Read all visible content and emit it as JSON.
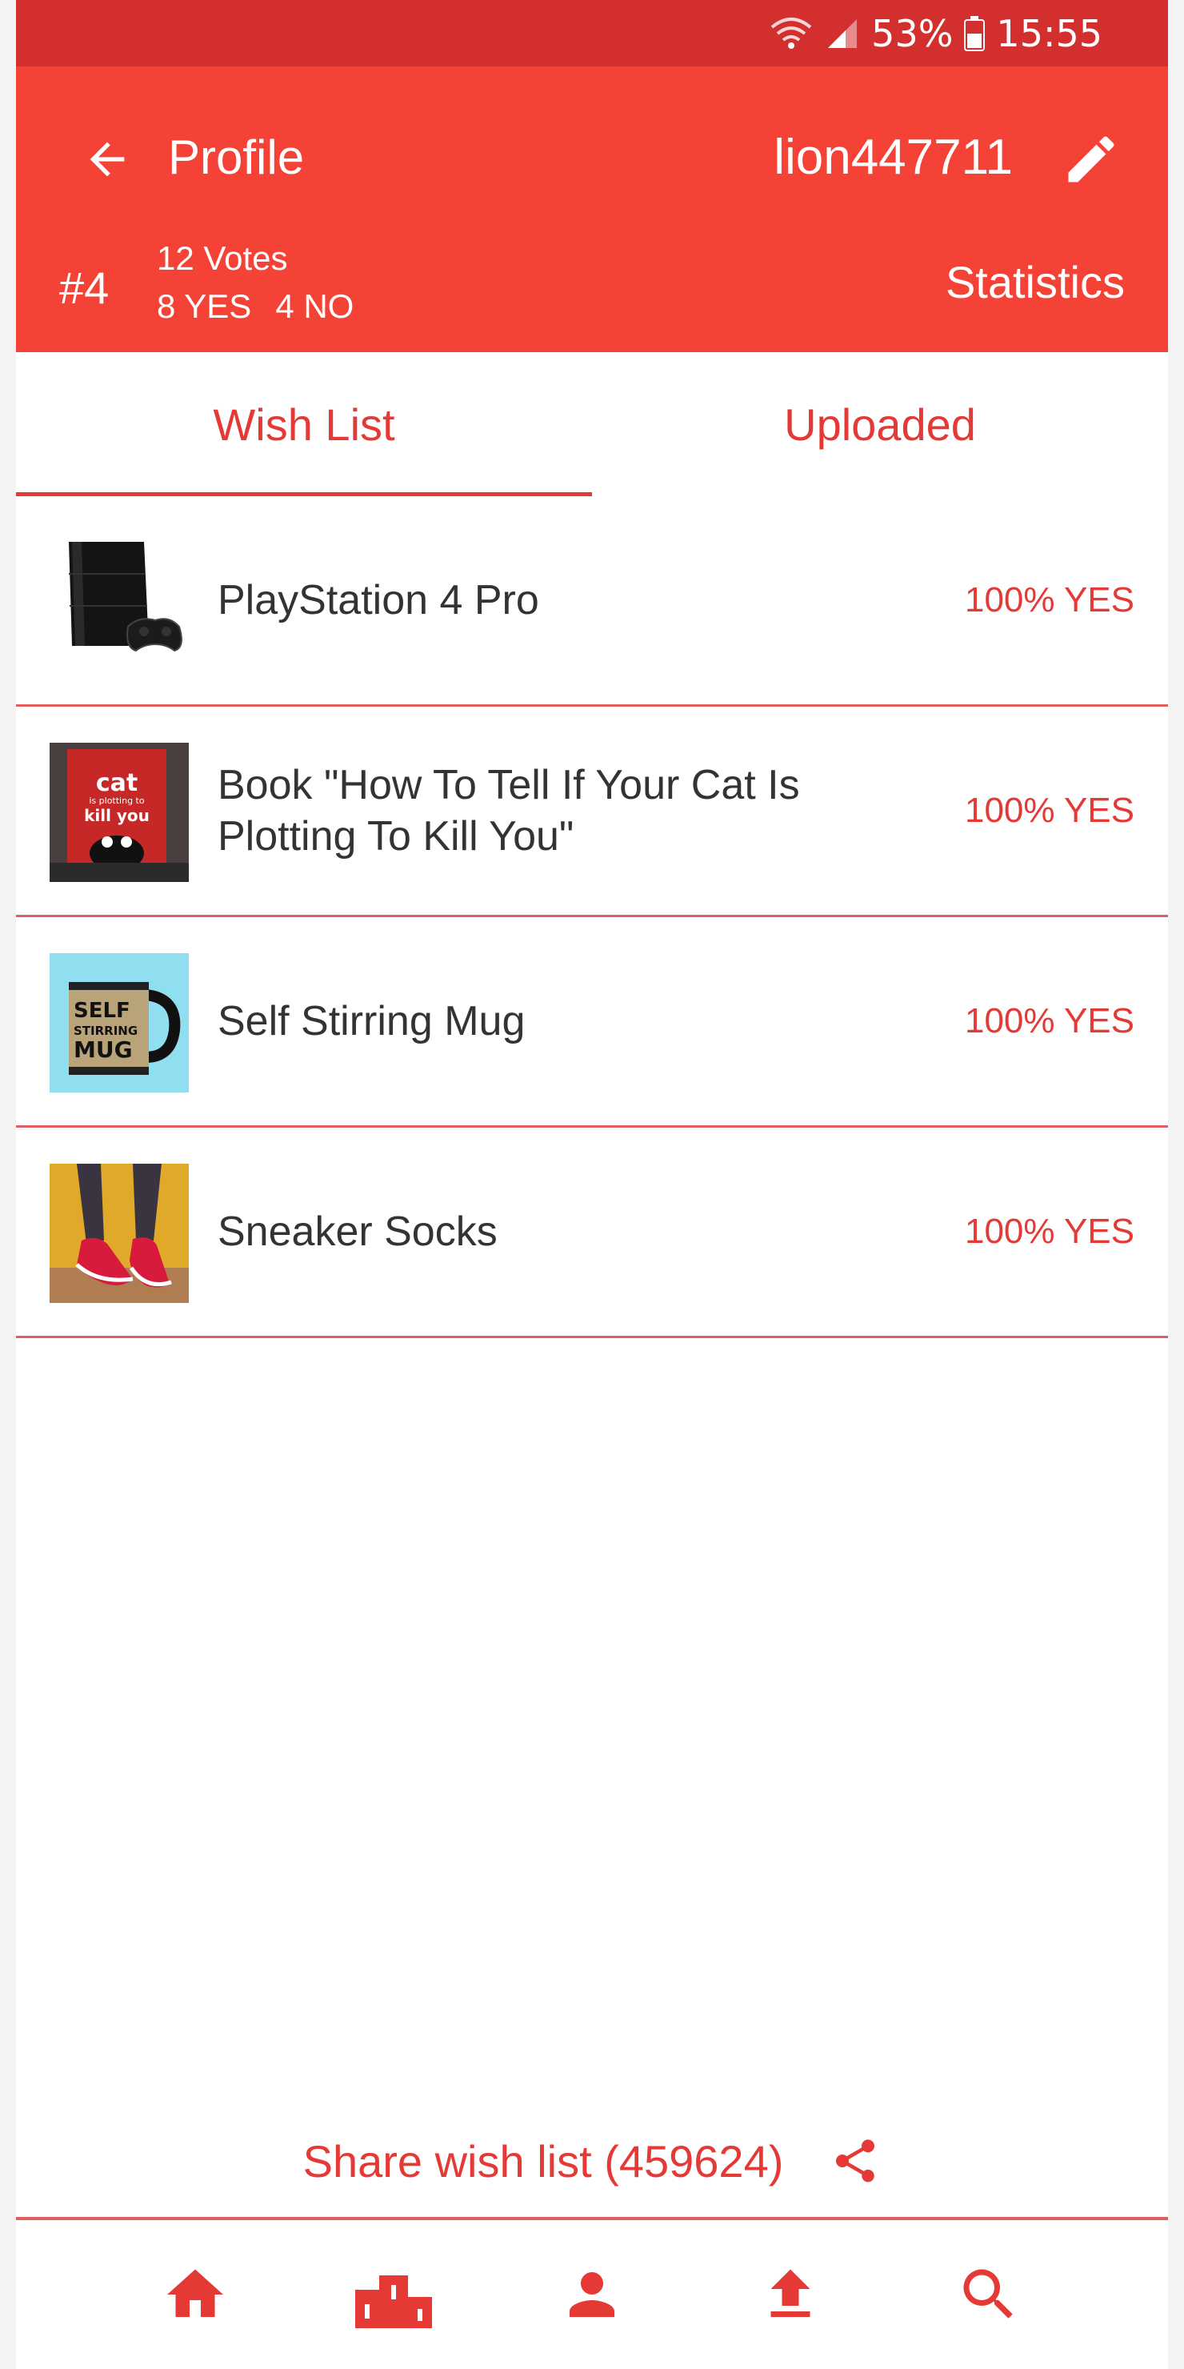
{
  "status_bar": {
    "battery": "53%",
    "time": "15:55"
  },
  "header": {
    "title": "Profile",
    "username": "lion447711",
    "rank": "#4",
    "votes": "12 Votes",
    "yes": "8 YES",
    "no": "4 NO",
    "statistics_label": "Statistics"
  },
  "tabs": [
    {
      "label": "Wish List",
      "active": true
    },
    {
      "label": "Uploaded",
      "active": false
    }
  ],
  "items": [
    {
      "name": "PlayStation 4 Pro",
      "pct": "100% YES"
    },
    {
      "name": "Book \"How To Tell If Your Cat Is Plotting To Kill You\"",
      "pct": "100% YES"
    },
    {
      "name": "Self Stirring Mug",
      "pct": "100% YES"
    },
    {
      "name": "Sneaker Socks",
      "pct": "100% YES"
    }
  ],
  "thumb_text": {
    "book": {
      "line1": "cat",
      "line2": "is plotting to",
      "line3": "kill you"
    },
    "mug": {
      "line1": "SELF",
      "line2": "STIRRING",
      "line3": "MUG"
    }
  },
  "share": {
    "label": "Share wish list (459624)"
  },
  "nav": [
    "home-icon",
    "leaderboard-icon",
    "profile-icon",
    "upload-icon",
    "search-icon"
  ],
  "colors": {
    "primary": "#f44336",
    "status_bar": "#d32f2f",
    "accent": "#e53935"
  }
}
